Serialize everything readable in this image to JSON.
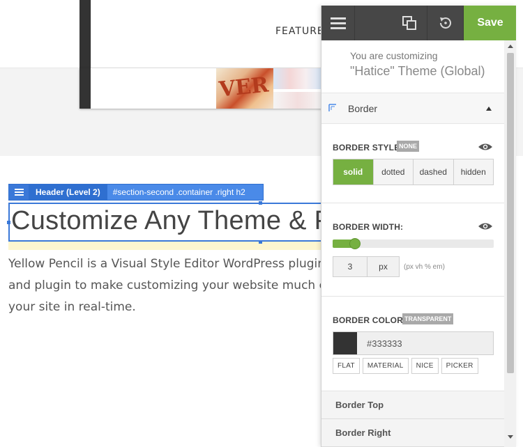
{
  "site": {
    "nav_item": "FEATURES",
    "tile_text": "VER",
    "heading": "Customize Any Theme & Plugin",
    "paragraph": [
      "Yellow Pencil is a Visual Style Editor WordPress plugin that",
      "and plugin to make customizing your website much easier",
      "your site in real-time."
    ]
  },
  "selection": {
    "type_label": "Header (Level 2)",
    "selector_path": "#section-second .container .right h2"
  },
  "panel": {
    "save_label": "Save",
    "info": {
      "subtitle": "You are customizing",
      "theme": "\"Hatice\" Theme (Global)"
    },
    "section_title": "Border",
    "border_style": {
      "label": "BORDER STYLE:",
      "badge": "NONE",
      "options": [
        "solid",
        "dotted",
        "dashed",
        "hidden"
      ],
      "selected": "solid"
    },
    "border_width": {
      "label": "BORDER WIDTH:",
      "value": "3",
      "unit": "px",
      "hint": "(px vh % em)",
      "slider_fraction": 0.14
    },
    "border_color": {
      "label": "BORDER COLOR:",
      "badge": "TRANSPARENT",
      "hex": "#333333",
      "tabs": [
        "FLAT",
        "MATERIAL",
        "NICE",
        "PICKER"
      ]
    },
    "subsections": [
      "Border Top",
      "Border Right"
    ]
  },
  "colors": {
    "accent_green": "#76b041",
    "selection_blue": "#4a8ae8",
    "toolbar_dark": "#474747",
    "swatch": "#333333"
  }
}
